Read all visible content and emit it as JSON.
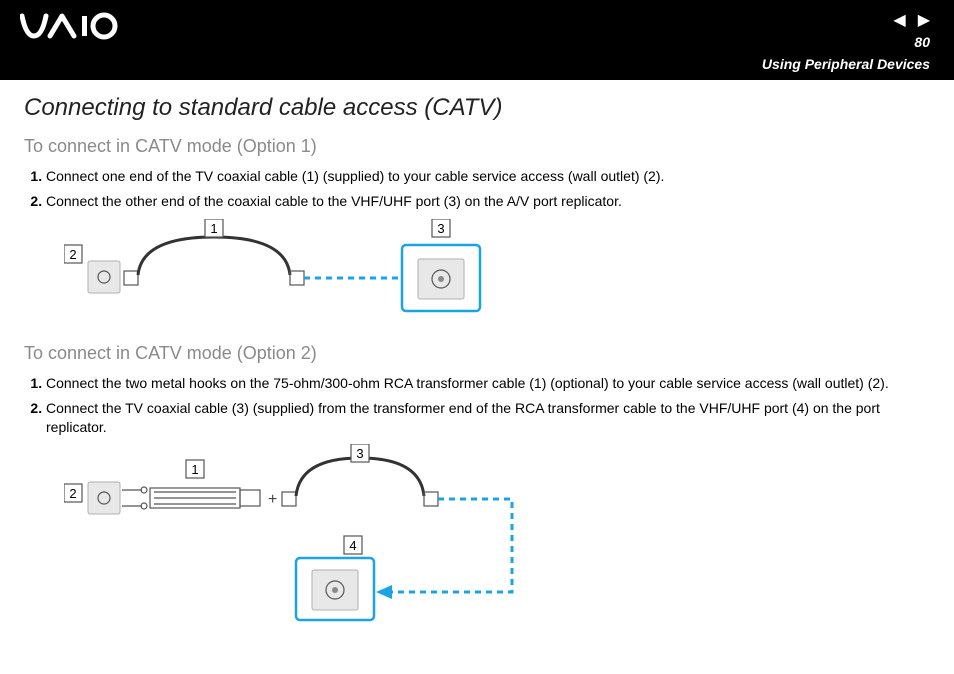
{
  "header": {
    "logo_text": "VAIO",
    "page_number": "80",
    "section": "Using Peripheral Devices"
  },
  "title": "Connecting to standard cable access (CATV)",
  "option1": {
    "heading": "To connect in CATV mode (Option 1)",
    "steps": [
      "Connect one end of the TV coaxial cable (1) (supplied) to your cable service access (wall outlet) (2).",
      "Connect the other end of the coaxial cable to the VHF/UHF port (3) on the A/V port replicator."
    ],
    "callouts": {
      "c1": "1",
      "c2": "2",
      "c3": "3"
    }
  },
  "option2": {
    "heading": "To connect in CATV mode (Option 2)",
    "steps": [
      "Connect the two metal hooks on the 75-ohm/300-ohm RCA transformer cable (1) (optional) to your cable service access (wall outlet) (2).",
      "Connect the TV coaxial cable (3) (supplied) from the transformer end of the RCA transformer cable to the VHF/UHF port (4) on the port replicator."
    ],
    "callouts": {
      "c1": "1",
      "c2": "2",
      "c3": "3",
      "c4": "4"
    }
  }
}
